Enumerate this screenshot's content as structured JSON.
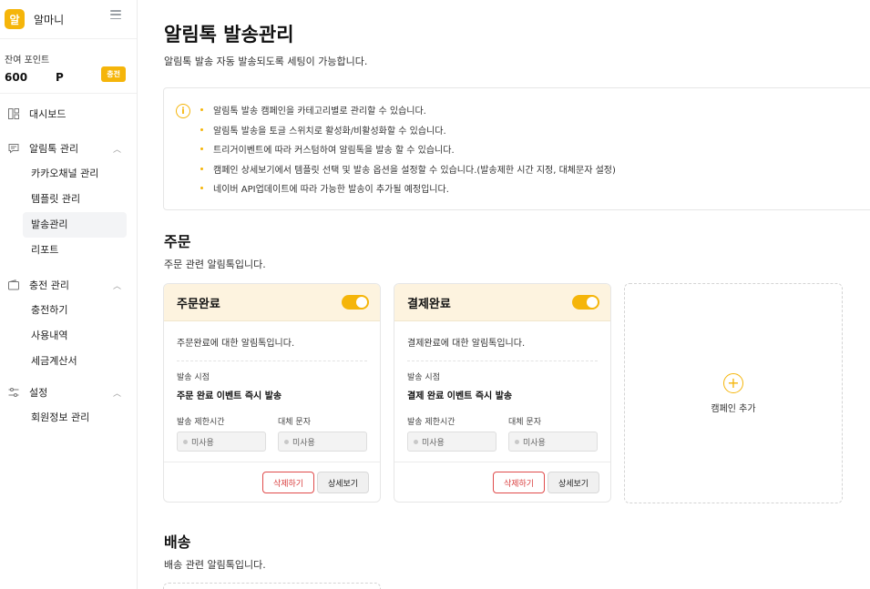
{
  "sidebar": {
    "logo_char": "알",
    "brand_name": "알마니",
    "points_label": "잔여 포인트",
    "points_value": "600",
    "points_unit": "P",
    "charge_label": "충전",
    "nav": {
      "dashboard": "대시보드",
      "alimtalk": "알림톡 관리",
      "alimtalk_items": [
        "카카오채널 관리",
        "템플릿 관리",
        "발송관리",
        "리포트"
      ],
      "charge": "충전 관리",
      "charge_items": [
        "충전하기",
        "사용내역",
        "세금계산서"
      ],
      "settings": "설정",
      "settings_items": [
        "회원정보 관리"
      ]
    }
  },
  "main": {
    "title": "알림톡 발송관리",
    "description": "알림톡 발송 자동 발송되도록 세팅이 가능합니다.",
    "info_icon_text": "i",
    "info": [
      "알림톡 발송 캠페인을 카테고리별로 관리할 수 있습니다.",
      "알림톡 발송을 토글 스위치로 활성화/비활성화할 수 있습니다.",
      "트리거이벤트에 따라 커스텀하여 알림톡을 발송 할 수 있습니다.",
      "캠페인 상세보기에서 템플릿 선택 및 발송 옵션을 설정할 수 있습니다.(발송제한 시간 지정, 대체문자 설정)",
      "네이버 API업데이트에 따라 가능한 발송이 추가될 예정입니다."
    ],
    "sections": [
      {
        "title": "주문",
        "description": "주문 관련 알림톡입니다.",
        "cards": [
          {
            "title": "주문완료",
            "description": "주문완료에 대한 알림톡입니다.",
            "timing_label": "발송 시점",
            "timing_value": "주문 완료 이벤트 즉시 발송",
            "limit_label": "발송 제한시간",
            "limit_value": "미사용",
            "sub_label": "대체 문자",
            "sub_value": "미사용",
            "delete_label": "삭제하기",
            "view_label": "상세보기"
          },
          {
            "title": "결제완료",
            "description": "결제완료에 대한 알림톡입니다.",
            "timing_label": "발송 시점",
            "timing_value": "결제 완료 이벤트 즉시 발송",
            "limit_label": "발송 제한시간",
            "limit_value": "미사용",
            "sub_label": "대체 문자",
            "sub_value": "미사용",
            "delete_label": "삭제하기",
            "view_label": "상세보기"
          }
        ],
        "add_label": "캠페인 추가"
      },
      {
        "title": "배송",
        "description": "배송 관련 알림톡입니다."
      }
    ]
  }
}
